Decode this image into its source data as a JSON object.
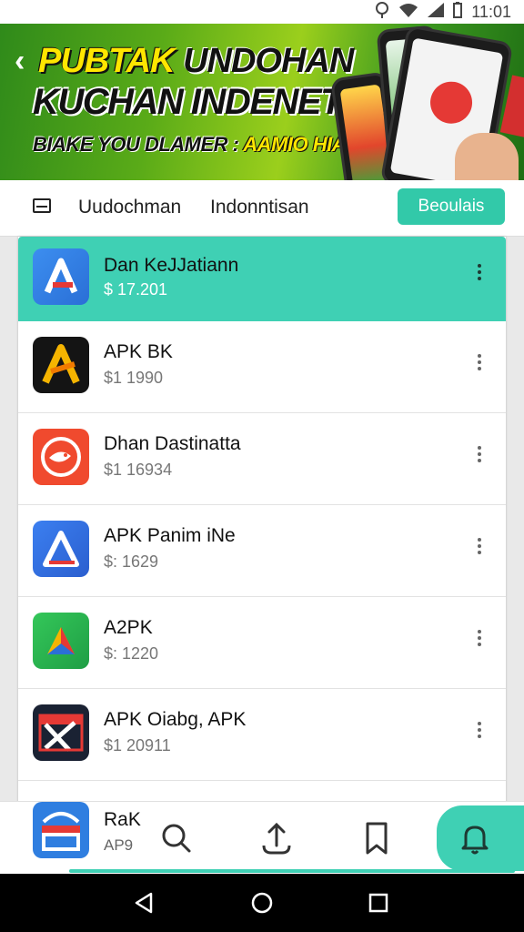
{
  "status_bar": {
    "time": "11:01",
    "icons": [
      "location-icon",
      "wifi-icon",
      "signal-icon",
      "battery-icon"
    ]
  },
  "banner": {
    "line1_part1": "PUBTAK",
    "line1_part2": "UNDOHAN",
    "line2": "KUCHAN INDENETSIA",
    "line3_part1": "BIAKE YOU DLAMER :",
    "line3_part2": "AAMIO HIA2A",
    "colors": {
      "highlight": "#ffe600",
      "background": "#5aab18"
    }
  },
  "tabs": {
    "tab_a": "Uudochman",
    "tab_b": "Indonntisan",
    "button_label": "Beoulais"
  },
  "apps": [
    {
      "name": "Dan KeJJatiann",
      "price": "$ 17.201",
      "icon": "app-logo-a-icon",
      "selected": true
    },
    {
      "name": "APK BK",
      "price": "$1 1990",
      "icon": "app-logo-a-yellow-icon",
      "selected": false
    },
    {
      "name": "Dhan Dastinatta",
      "price": "$1 16934",
      "icon": "app-logo-fish-icon",
      "selected": false
    },
    {
      "name": "APK Panim iNe",
      "price": "$: 1629",
      "icon": "app-logo-triangle-icon",
      "selected": false
    },
    {
      "name": "A2PK",
      "price": "$: 1220",
      "icon": "app-logo-play-icon",
      "selected": false
    },
    {
      "name": "APK Oiabg, APK",
      "price": "$1 20911",
      "icon": "app-logo-x-icon",
      "selected": false
    }
  ],
  "peek_app": {
    "name": "RaK",
    "price": "AP9",
    "icon": "app-logo-shop-icon"
  },
  "bottom_nav": {
    "items": [
      "search-icon",
      "upload-icon",
      "bookmark-icon",
      "notification-icon"
    ],
    "active": "notification-icon",
    "accent": "#3fd0b4"
  },
  "system_nav": [
    "back-icon",
    "home-icon",
    "recents-icon"
  ]
}
